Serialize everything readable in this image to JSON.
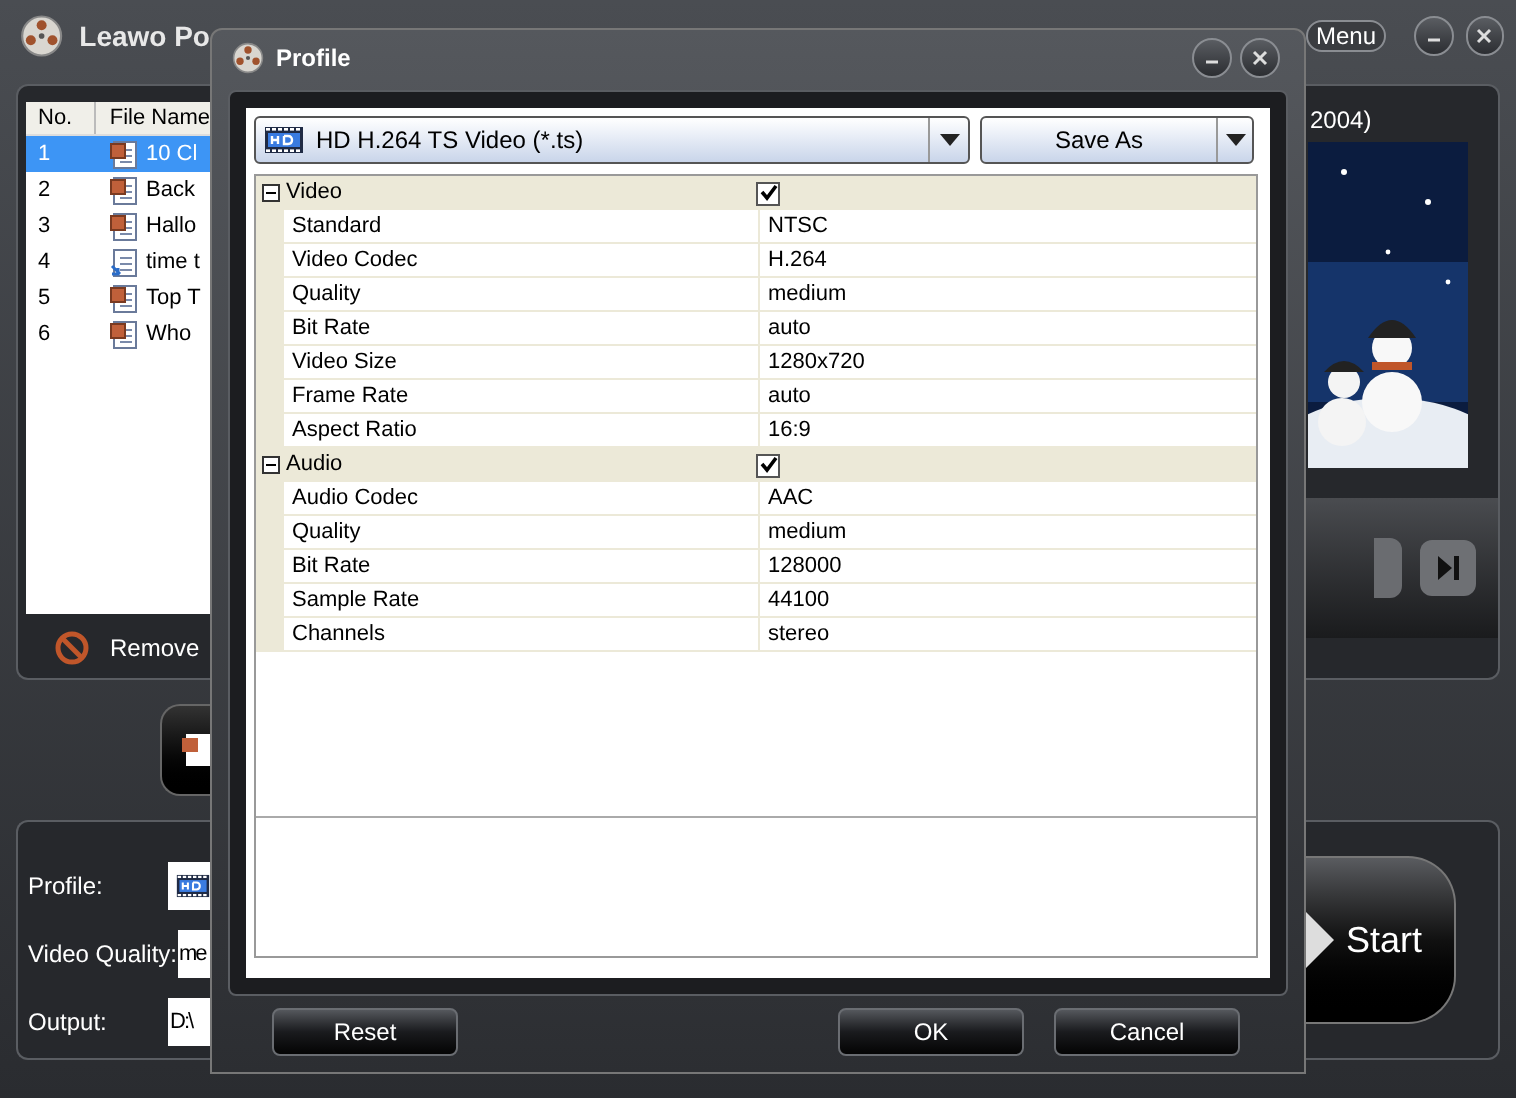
{
  "main_window": {
    "title": "Leawo Po",
    "menu_label": "Menu",
    "file_list": {
      "columns": [
        "No.",
        "File Name"
      ],
      "rows": [
        {
          "no": "1",
          "name": "10 Cl",
          "selected": true
        },
        {
          "no": "2",
          "name": "Back",
          "selected": false
        },
        {
          "no": "3",
          "name": "Hallo",
          "selected": false
        },
        {
          "no": "4",
          "name": "time t",
          "selected": false
        },
        {
          "no": "5",
          "name": "Top T",
          "selected": false
        },
        {
          "no": "6",
          "name": "Who",
          "selected": false
        }
      ]
    },
    "remove_label": "Remove",
    "profile_label": "Profile:",
    "video_quality_label": "Video Quality:",
    "video_quality_value": "me",
    "output_label": "Output:",
    "output_value": "D:\\",
    "preview_title": "2004)",
    "start_label": "Start"
  },
  "dialog": {
    "title": "Profile",
    "format": "HD H.264 TS Video (*.ts)",
    "save_as": "Save As",
    "groups": [
      {
        "name": "Video",
        "checked": true,
        "expanded": true,
        "properties": [
          {
            "name": "Standard",
            "value": "NTSC"
          },
          {
            "name": "Video Codec",
            "value": "H.264"
          },
          {
            "name": "Quality",
            "value": "medium"
          },
          {
            "name": "Bit Rate",
            "value": "auto"
          },
          {
            "name": "Video Size",
            "value": "1280x720"
          },
          {
            "name": "Frame Rate",
            "value": "auto"
          },
          {
            "name": "Aspect Ratio",
            "value": "16:9"
          }
        ]
      },
      {
        "name": "Audio",
        "checked": true,
        "expanded": true,
        "properties": [
          {
            "name": "Audio Codec",
            "value": "AAC"
          },
          {
            "name": "Quality",
            "value": "medium"
          },
          {
            "name": "Bit Rate",
            "value": "128000"
          },
          {
            "name": "Sample Rate",
            "value": "44100"
          },
          {
            "name": "Channels",
            "value": "stereo"
          }
        ]
      }
    ],
    "buttons": [
      "Reset",
      "OK",
      "Cancel"
    ]
  }
}
